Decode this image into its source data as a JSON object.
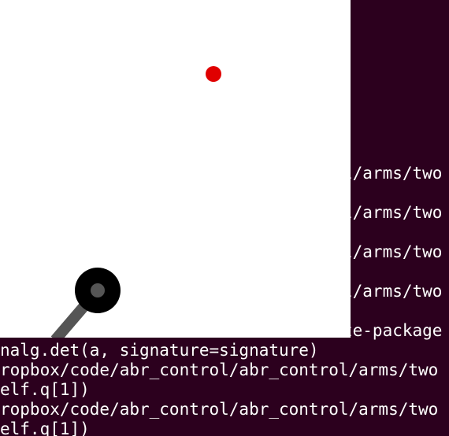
{
  "terminal": {
    "background": "#2c001e",
    "foreground": "#ffffff",
    "lines": [
      {
        "text": "l/arms/two",
        "side": "right"
      },
      {
        "text": "l/arms/two",
        "side": "right"
      },
      {
        "text": "l/arms/two",
        "side": "right"
      },
      {
        "text": "l/arms/two",
        "side": "right"
      },
      {
        "text": "te-package",
        "side": "right"
      },
      {
        "text": "nalg.det(a, signature=signature)",
        "side": "left"
      },
      {
        "text": "ropbox/code/abr_control/abr_control/arms/two",
        "side": "left"
      },
      {
        "text": "elf.q[1])",
        "side": "left"
      },
      {
        "text": "ropbox/code/abr_control/abr_control/arms/two",
        "side": "left"
      },
      {
        "text": "elf.q[1])",
        "side": "left"
      }
    ]
  },
  "simulation": {
    "background": "#ffffff",
    "target_color": "#e00000",
    "joint_color": "#000000",
    "joint_inner_color": "#555555",
    "link_color": "#555555"
  }
}
